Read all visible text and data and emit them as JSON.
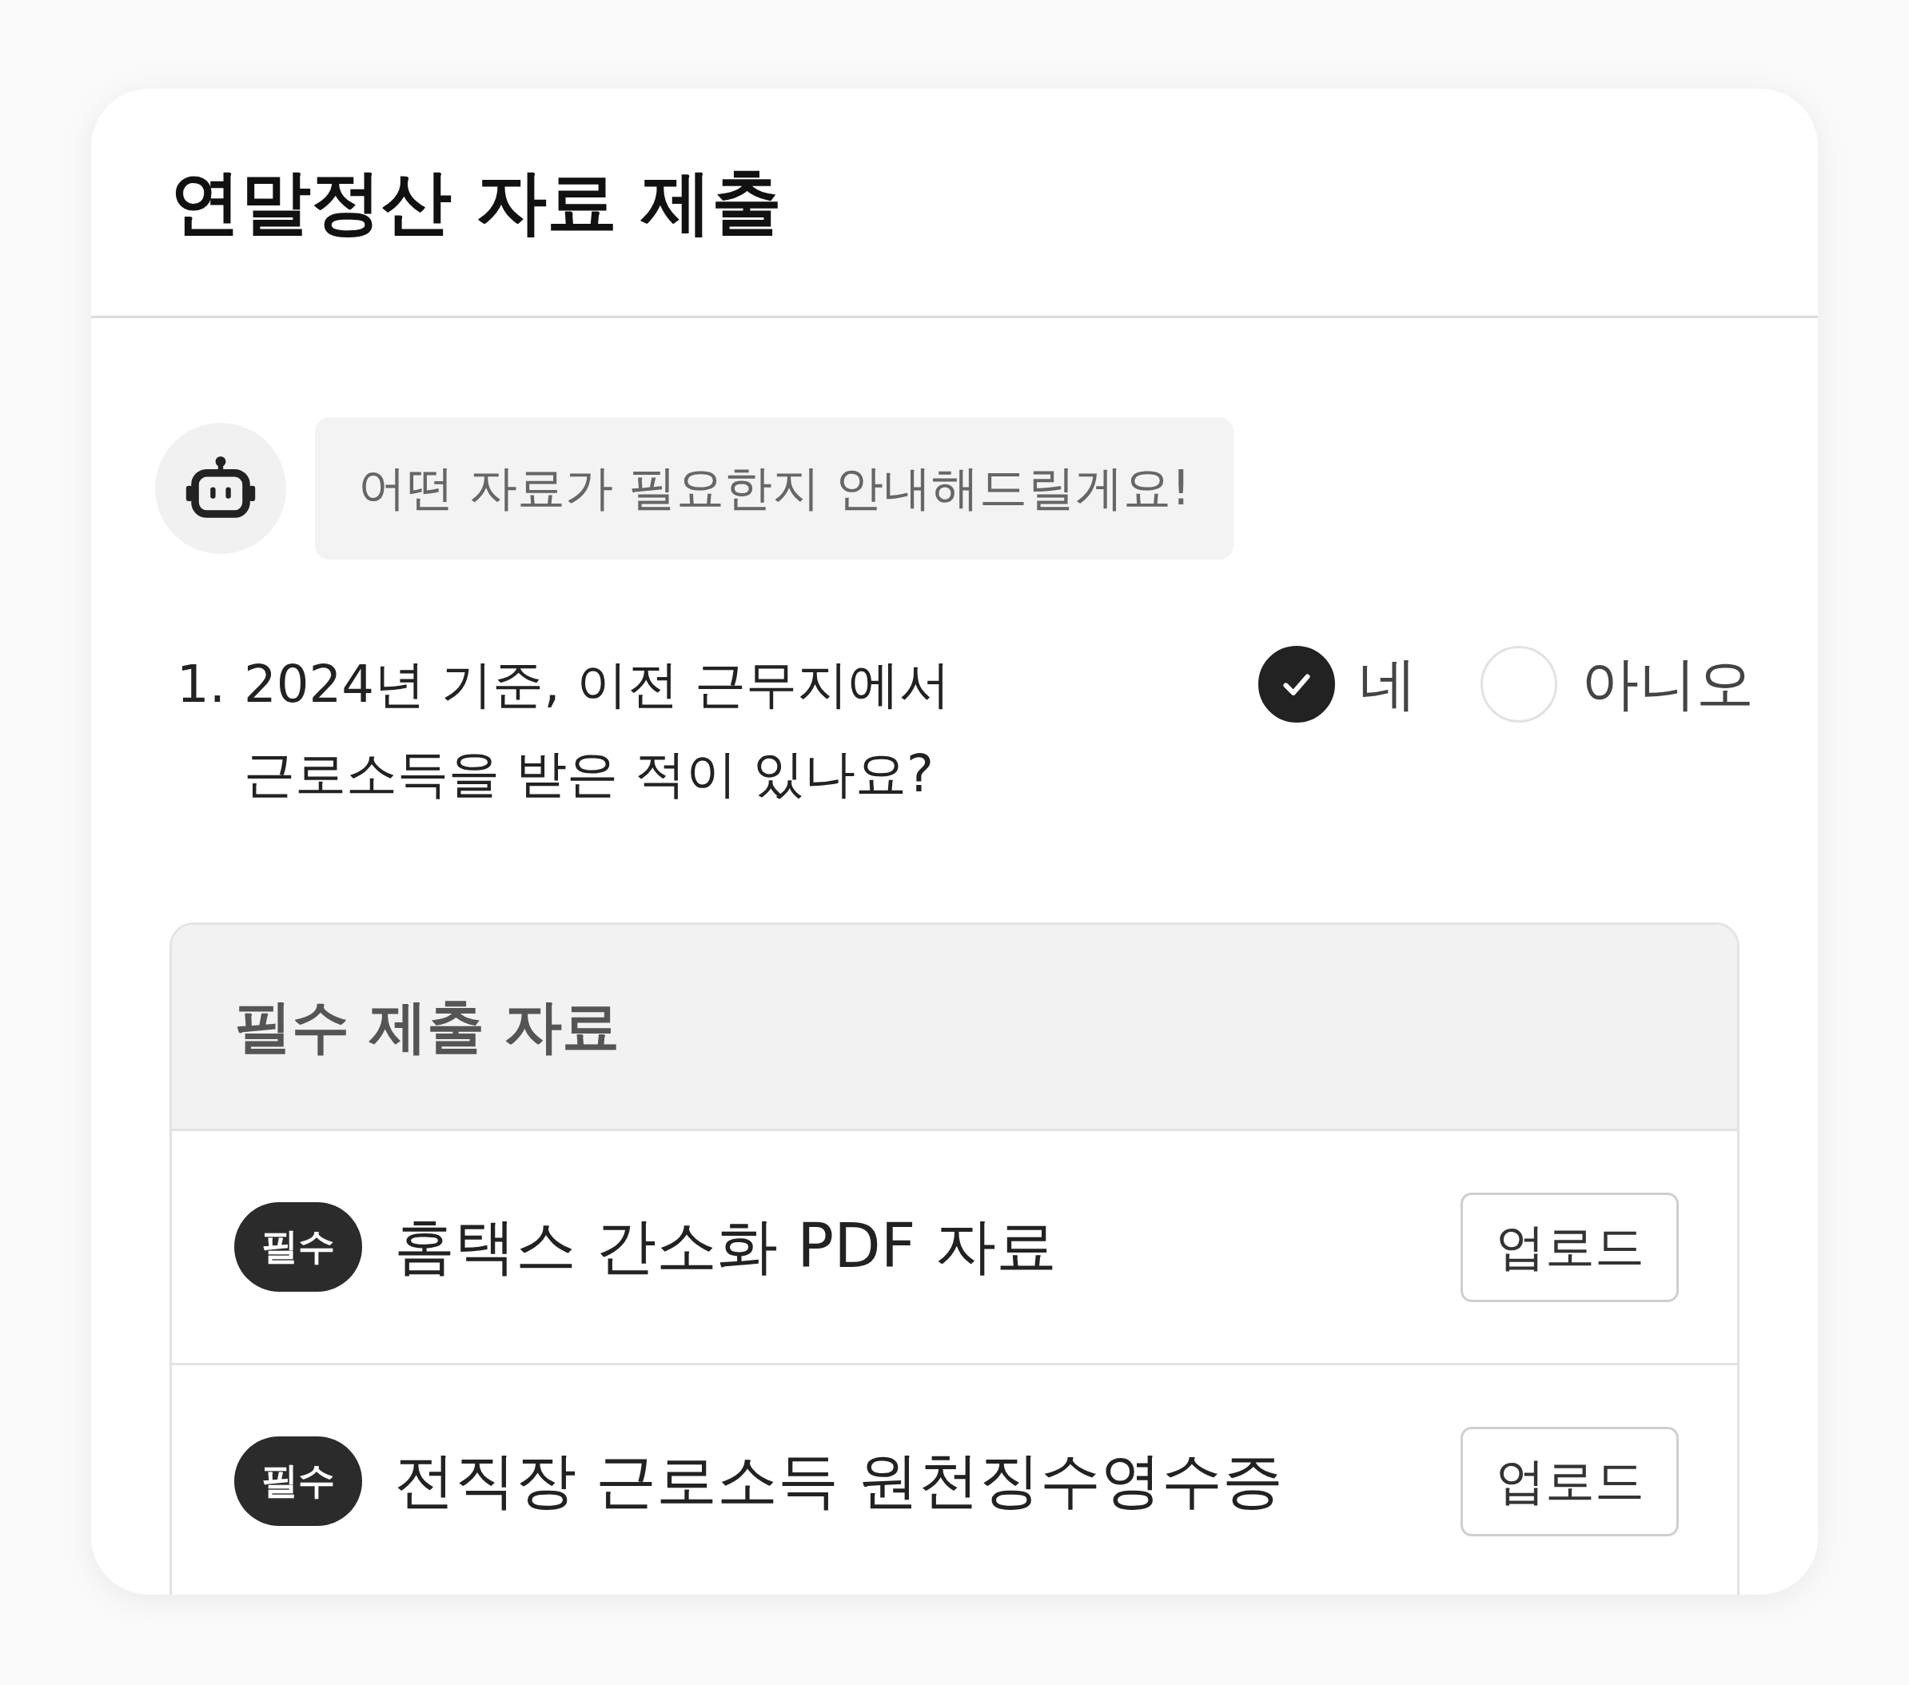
{
  "title": "연말정산 자료 제출",
  "bot_message": "어떤 자료가 필요한지 안내해드릴게요!",
  "question": {
    "number": "1.",
    "text": "2024년 기준, 이전 근무지에서\n근로소득을 받은 적이 있나요?",
    "options": [
      {
        "label": "네",
        "selected": true
      },
      {
        "label": "아니오",
        "selected": false
      }
    ]
  },
  "section": {
    "title": "필수 제출 자료",
    "items": [
      {
        "badge": "필수",
        "name": "홈택스 간소화 PDF 자료",
        "button": "업로드"
      },
      {
        "badge": "필수",
        "name": "전직장 근로소득 원천징수영수증",
        "button": "업로드"
      }
    ]
  }
}
